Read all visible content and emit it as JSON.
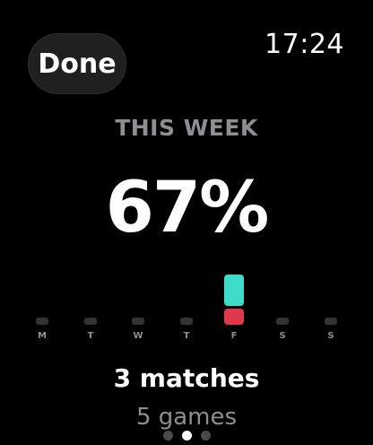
{
  "header": {
    "done_label": "Done",
    "time": "17:24"
  },
  "summary": {
    "period": "THIS WEEK",
    "win_percentage": "67%",
    "matches": "3 matches",
    "games": "5 games"
  },
  "week": [
    {
      "label": "M",
      "wins": 0,
      "losses": 0
    },
    {
      "label": "T",
      "wins": 0,
      "losses": 0
    },
    {
      "label": "W",
      "wins": 0,
      "losses": 0
    },
    {
      "label": "T",
      "wins": 0,
      "losses": 0
    },
    {
      "label": "F",
      "wins": 2,
      "losses": 1
    },
    {
      "label": "S",
      "wins": 0,
      "losses": 0
    },
    {
      "label": "S",
      "wins": 0,
      "losses": 0
    }
  ],
  "colors": {
    "win": "#3ddbc8",
    "loss": "#e0394d",
    "empty": "#333333"
  },
  "pagination": {
    "count": 3,
    "active": 1
  }
}
